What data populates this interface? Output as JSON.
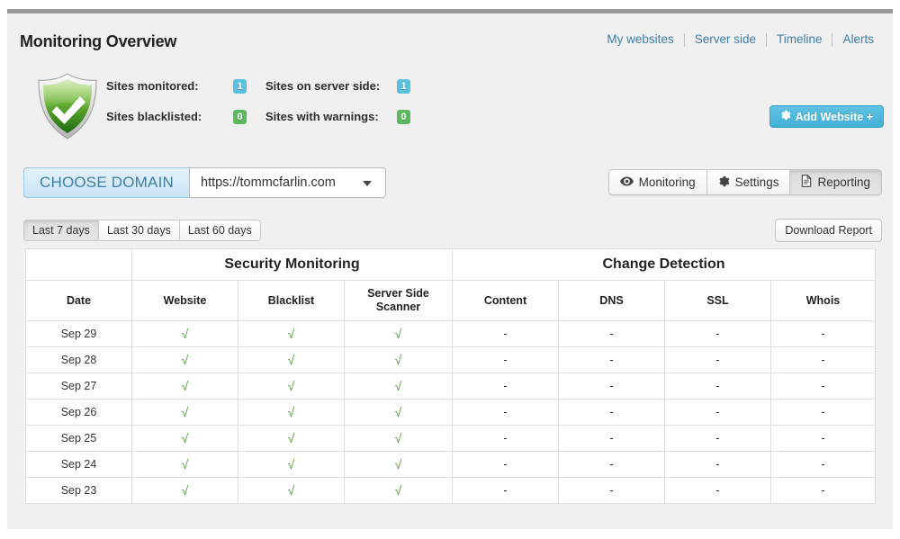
{
  "header": {
    "title": "Monitoring Overview",
    "nav": [
      {
        "label": "My websites"
      },
      {
        "label": "Server side"
      },
      {
        "label": "Timeline"
      },
      {
        "label": "Alerts"
      }
    ]
  },
  "summary": {
    "shield_icon": "green-shield-check-icon",
    "rows": [
      {
        "left_label": "Sites monitored:",
        "left_value": "1",
        "left_color": "#5bc0de",
        "right_label": "Sites on server side:",
        "right_value": "1",
        "right_color": "#5bc0de"
      },
      {
        "left_label": "Sites blacklisted:",
        "left_value": "0",
        "left_color": "#5cb85c",
        "right_label": "Sites with warnings:",
        "right_value": "0",
        "right_color": "#5cb85c"
      }
    ]
  },
  "add_website": {
    "label": "Add Website +",
    "icon": "gear-icon",
    "accent": "#42afd4"
  },
  "domain": {
    "chooser_label": "CHOOSE DOMAIN",
    "selected": "https://tommcfarlin.com",
    "caret_icon": "chevron-down-icon"
  },
  "view_tabs": [
    {
      "label": "Monitoring",
      "icon": "eye-icon",
      "active": false
    },
    {
      "label": "Settings",
      "icon": "gear-icon",
      "active": false
    },
    {
      "label": "Reporting",
      "icon": "document-icon",
      "active": true
    }
  ],
  "range_tabs": [
    {
      "label": "Last 7 days",
      "active": true
    },
    {
      "label": "Last 30 days",
      "active": false
    },
    {
      "label": "Last 60 days",
      "active": false
    }
  ],
  "download_report": {
    "label": "Download Report"
  },
  "report_table": {
    "group_headers": [
      {
        "label": "",
        "span": 1
      },
      {
        "label": "Security Monitoring",
        "span": 3
      },
      {
        "label": "Change Detection",
        "span": 4
      }
    ],
    "columns": [
      "Date",
      "Website",
      "Blacklist",
      "Server Side Scanner",
      "Content",
      "DNS",
      "SSL",
      "Whois"
    ],
    "check_symbol": "√",
    "na_symbol": "-",
    "rows": [
      {
        "date": "Sep 29",
        "website": "√",
        "blacklist": "√",
        "server_side_scanner": "√",
        "content": "-",
        "dns": "-",
        "ssl": "-",
        "whois": "-"
      },
      {
        "date": "Sep 28",
        "website": "√",
        "blacklist": "√",
        "server_side_scanner": "√",
        "content": "-",
        "dns": "-",
        "ssl": "-",
        "whois": "-"
      },
      {
        "date": "Sep 27",
        "website": "√",
        "blacklist": "√",
        "server_side_scanner": "√",
        "content": "-",
        "dns": "-",
        "ssl": "-",
        "whois": "-"
      },
      {
        "date": "Sep 26",
        "website": "√",
        "blacklist": "√",
        "server_side_scanner": "√",
        "content": "-",
        "dns": "-",
        "ssl": "-",
        "whois": "-"
      },
      {
        "date": "Sep 25",
        "website": "√",
        "blacklist": "√",
        "server_side_scanner": "√",
        "content": "-",
        "dns": "-",
        "ssl": "-",
        "whois": "-"
      },
      {
        "date": "Sep 24",
        "website": "√",
        "blacklist": "√",
        "server_side_scanner": "√",
        "content": "-",
        "dns": "-",
        "ssl": "-",
        "whois": "-"
      },
      {
        "date": "Sep 23",
        "website": "√",
        "blacklist": "√",
        "server_side_scanner": "√",
        "content": "-",
        "dns": "-",
        "ssl": "-",
        "whois": "-"
      }
    ]
  }
}
